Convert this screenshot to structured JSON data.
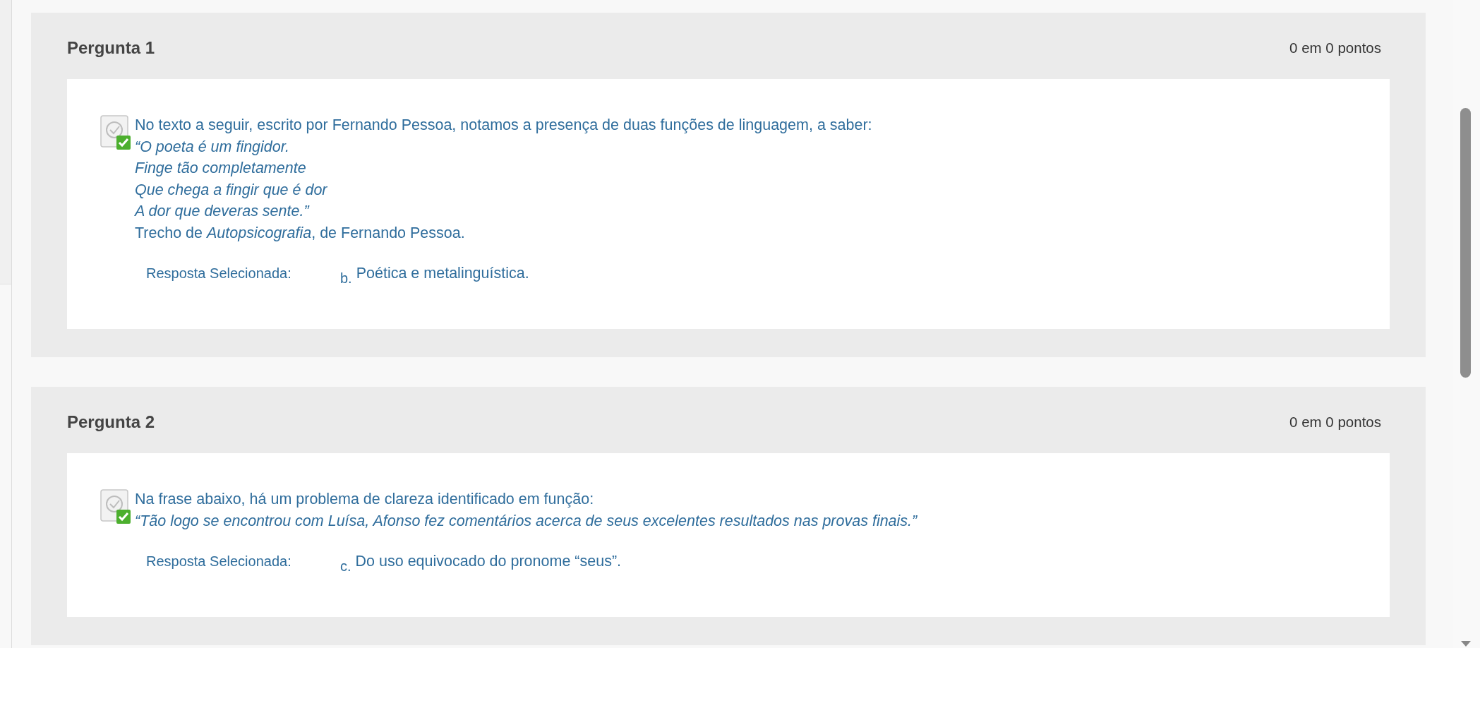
{
  "questions": [
    {
      "title": "Pergunta 1",
      "score": "0 em 0 pontos",
      "correct": true,
      "lines": [
        "No texto a seguir, escrito por Fernando Pessoa, notamos a presença de duas funções de linguagem, a saber:",
        "*“O poeta é um fingidor.*",
        "*Finge tão completamente*",
        "*Que chega a fingir que é dor*",
        "*A dor que deveras sente.”*",
        "Trecho de *Autopsicografia*, de Fernando Pessoa."
      ],
      "answer_label": "Resposta Selecionada:",
      "answer_letter": "b.",
      "answer": "Poética e metalinguística."
    },
    {
      "title": "Pergunta 2",
      "score": "0 em 0 pontos",
      "correct": true,
      "lines": [
        "Na frase abaixo, há um problema de clareza identificado em função:",
        "*“Tão logo se encontrou com Luísa, Afonso fez comentários acerca de seus excelentes resultados nas provas finais.”*"
      ],
      "answer_label": "Resposta Selecionada:",
      "answer_letter": "c.",
      "answer": "Do uso equivocado do pronome “seus”."
    }
  ]
}
